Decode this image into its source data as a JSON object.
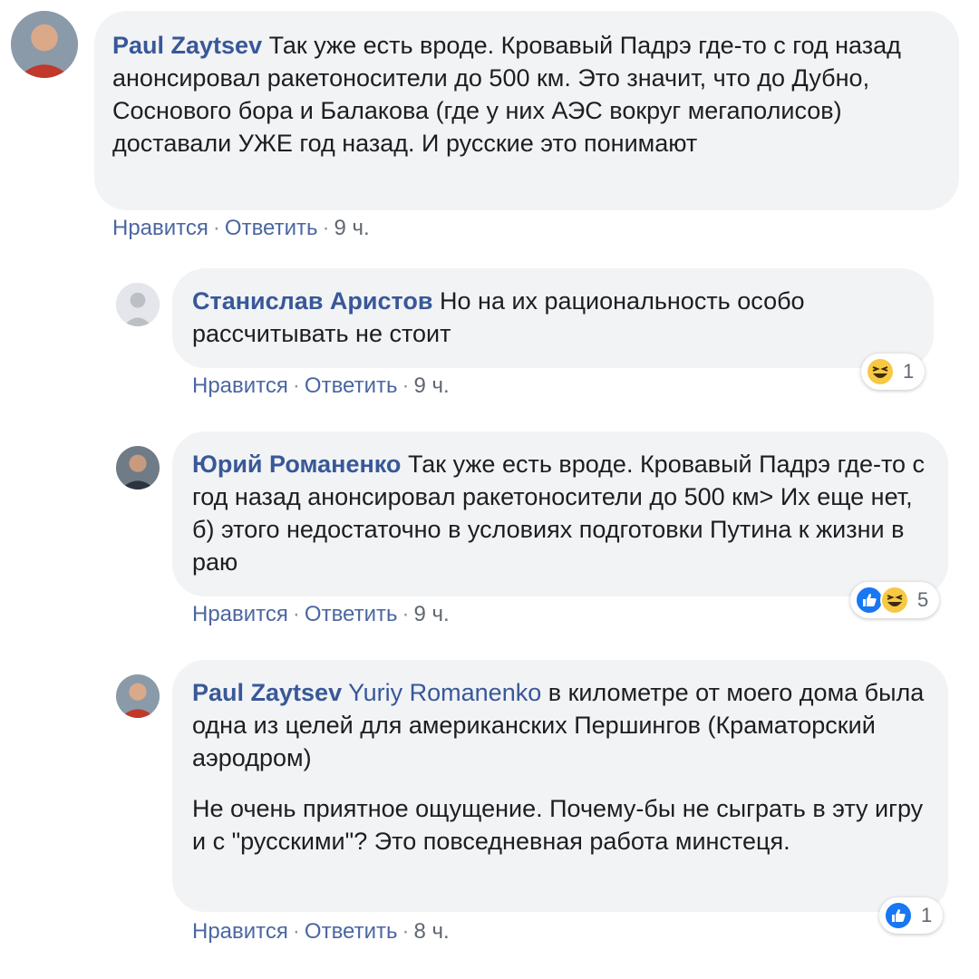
{
  "comments": [
    {
      "author": "Paul Zaytsev",
      "paragraphs": [
        "Так уже есть вроде. Кровавый Падрэ где-то с год назад анонсировал ракетоносители до 500 км. Это значит, что до Дубно, Соснового бора и Балакова (где у них АЭС вокруг мегаполисов) доставали УЖЕ год назад. И русские это понимают"
      ],
      "like_label": "Нравится",
      "reply_label": "Ответить",
      "time": "9 ч."
    },
    {
      "author": "Станислав Аристов",
      "paragraphs": [
        "Но на их рациональность особо рассчитывать не стоит"
      ],
      "like_label": "Нравится",
      "reply_label": "Ответить",
      "time": "9 ч.",
      "reactions": {
        "icons": [
          "haha-icon"
        ],
        "count": "1"
      }
    },
    {
      "author": "Юрий Романенко",
      "paragraphs": [
        "Так уже есть вроде. Кровавый Падрэ где-то с год назад анонсировал ракетоносители до 500 км> Их еще нет, б) этого недостаточно в условиях подготовки Путина к жизни в раю"
      ],
      "like_label": "Нравится",
      "reply_label": "Ответить",
      "time": "9 ч.",
      "reactions": {
        "icons": [
          "like-icon",
          "haha-icon"
        ],
        "count": "5"
      }
    },
    {
      "author": "Paul Zaytsev",
      "mention": "Yuriy Romanenko",
      "paragraphs": [
        "в километре от моего дома была одна из целей для американских Першингов (Краматорский аэродром)",
        "Не очень приятное ощущение. Почему-бы не сыграть в эту игру и с \"русскими\"? Это повседневная работа минстеця."
      ],
      "like_label": "Нравится",
      "reply_label": "Ответить",
      "time": "8 ч.",
      "reactions": {
        "icons": [
          "like-icon"
        ],
        "count": "1"
      }
    }
  ],
  "colors": {
    "author": "#385898",
    "bubble": "#f2f3f5",
    "like_blue": "#1877f2",
    "haha_yellow": "#f7c843"
  }
}
